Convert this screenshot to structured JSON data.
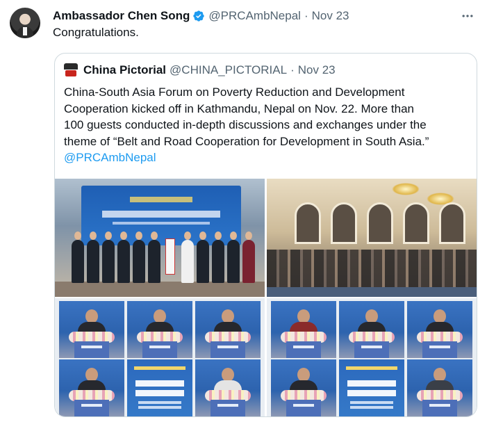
{
  "tweet": {
    "author_name": "Ambassador Chen Song",
    "handle": "@PRCAmbNepal",
    "separator": "·",
    "time": "Nov 23",
    "text": "Congratulations.",
    "more_icon": "more-horizontal-icon",
    "verified_color": "#1d9bf0"
  },
  "quoted": {
    "author_name": "China Pictorial",
    "handle": "@CHINA_PICTORIAL",
    "separator": "·",
    "time": "Nov 23",
    "text_lines": [
      "China-South Asia Forum on Poverty Reduction and Development",
      "Cooperation kicked off in Kathmandu, Nepal on Nov. 22. More than",
      "100 guests conducted in-depth discussions and exchanges under the",
      "theme of “Belt and Road Cooperation for Development in South Asia.”",
      "@PRCAmbNepal"
    ],
    "photos": [
      "forum-opening-ceremony-stage",
      "forum-audience-hall",
      "speakers-collage-left",
      "speakers-collage-right"
    ]
  }
}
